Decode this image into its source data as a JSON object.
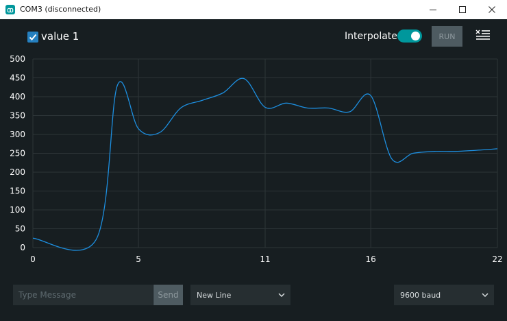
{
  "window": {
    "title": "COM3 (disconnected)",
    "controls": [
      "minimize-icon",
      "maximize-icon",
      "close-icon"
    ]
  },
  "toolbar": {
    "series_checked": true,
    "series_label": "value 1",
    "interpolate_label": "Interpolate",
    "interpolate_on": true,
    "run_label": "RUN",
    "clear_icon": "clear-list-icon"
  },
  "footer": {
    "message_placeholder": "Type Message",
    "send_label": "Send",
    "line_ending": "New Line",
    "baud": "9600 baud"
  },
  "colors": {
    "accent": "#00979c",
    "line": "#1d8fe0",
    "background": "#171e21",
    "grid": "#2d3538"
  },
  "chart_data": {
    "type": "line",
    "xlim": [
      0,
      22
    ],
    "ylim": [
      0,
      500
    ],
    "xticks": [
      0,
      5,
      11,
      16,
      22
    ],
    "yticks": [
      0,
      50,
      100,
      150,
      200,
      250,
      300,
      350,
      400,
      450,
      500
    ],
    "grid": true,
    "interpolate": true,
    "series": [
      {
        "name": "value 1",
        "x": [
          0,
          3,
          4,
          5,
          6,
          7,
          8,
          9,
          10,
          11,
          12,
          13,
          14,
          15,
          16,
          17,
          18,
          19,
          20,
          21,
          22
        ],
        "y": [
          25,
          22,
          430,
          315,
          305,
          370,
          390,
          410,
          448,
          372,
          383,
          370,
          370,
          360,
          403,
          235,
          250,
          255,
          255,
          258,
          262
        ]
      }
    ]
  }
}
